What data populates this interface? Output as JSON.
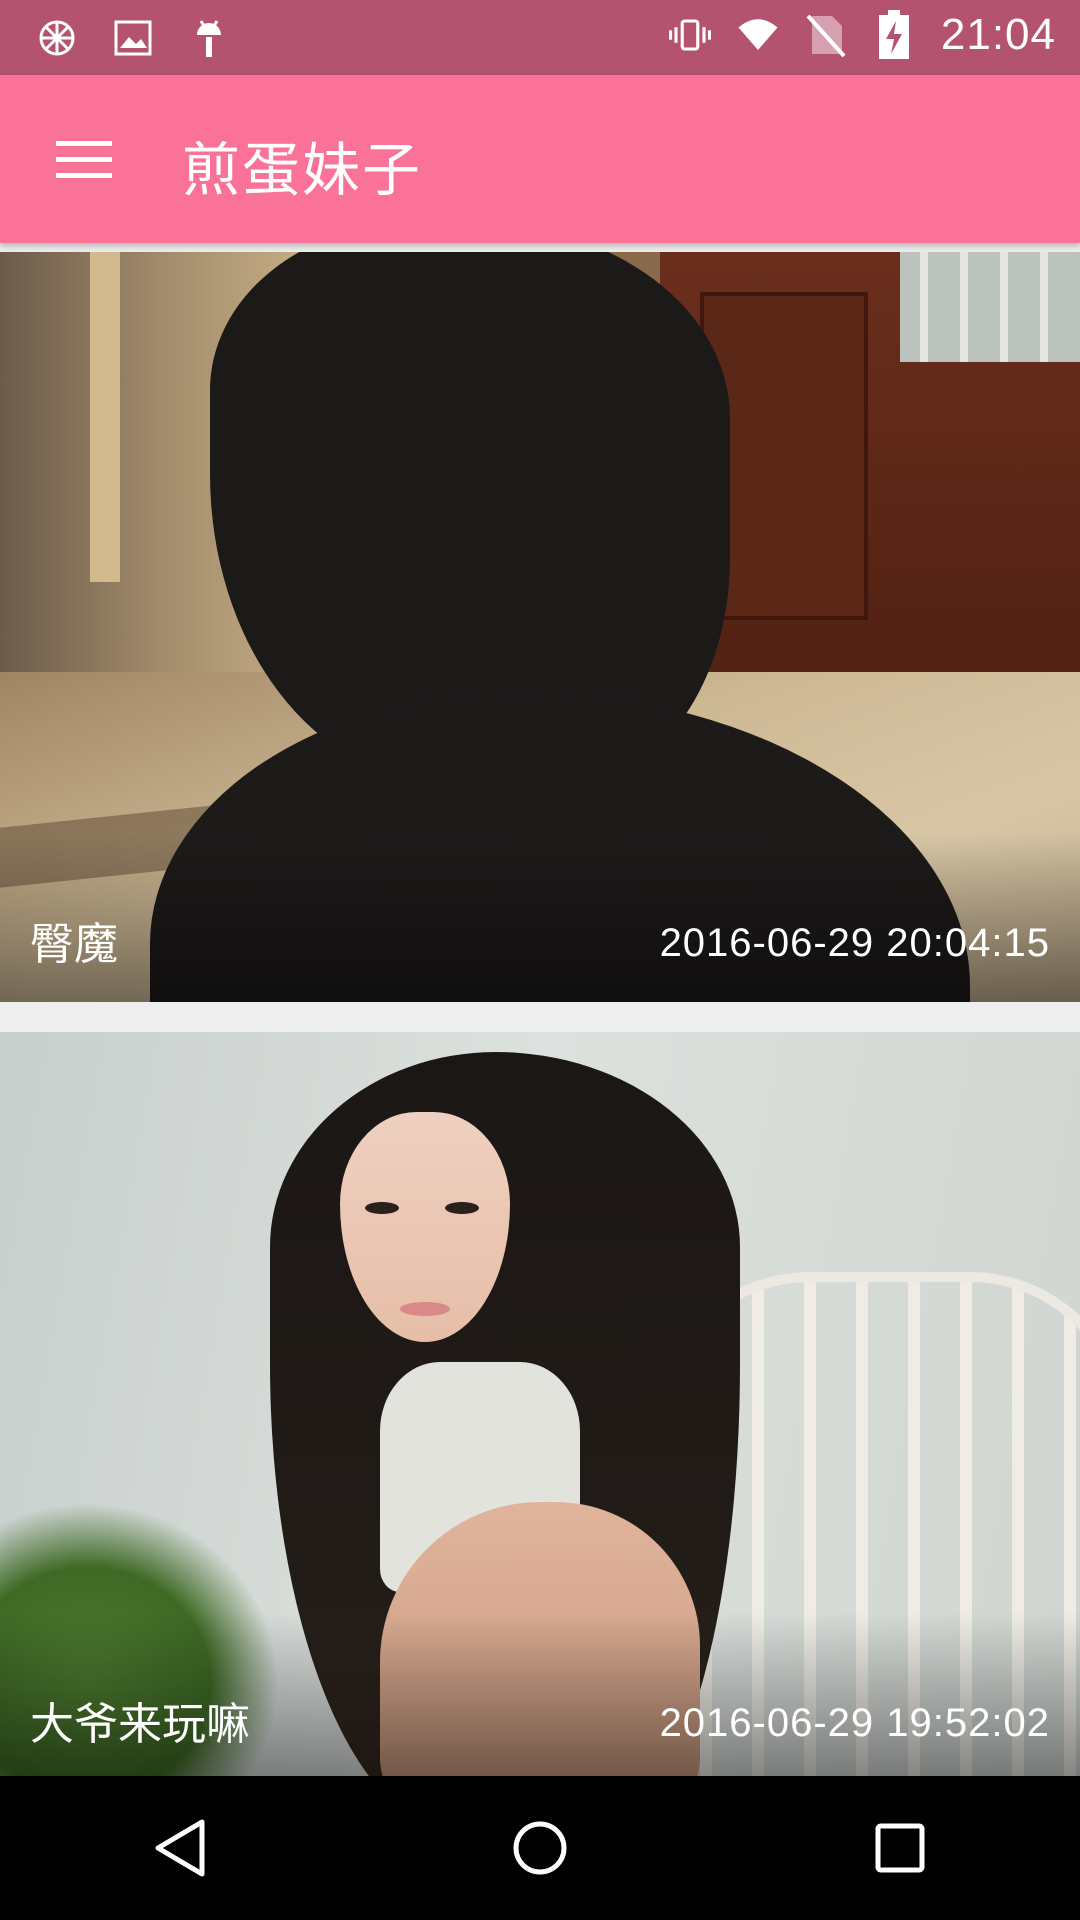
{
  "status_bar": {
    "time": "21:04",
    "left_icons": [
      "app-notification-icon",
      "image-notification-icon",
      "android-debug-icon"
    ],
    "right_icons": [
      "vibrate-icon",
      "wifi-icon",
      "no-sim-icon",
      "battery-charging-icon"
    ]
  },
  "app_bar": {
    "title": "煎蛋妹子",
    "menu_icon": "hamburger-menu-icon",
    "color": "#fb7299"
  },
  "status_bar_color": "#b4536f",
  "feed": {
    "items": [
      {
        "title": "臀魔",
        "date": "2016-06-29 20:04:15"
      },
      {
        "title": "大爷来玩嘛",
        "date": "2016-06-29 19:52:02"
      }
    ]
  },
  "nav_bar": {
    "buttons": [
      "back-icon",
      "home-icon",
      "recents-icon"
    ]
  }
}
